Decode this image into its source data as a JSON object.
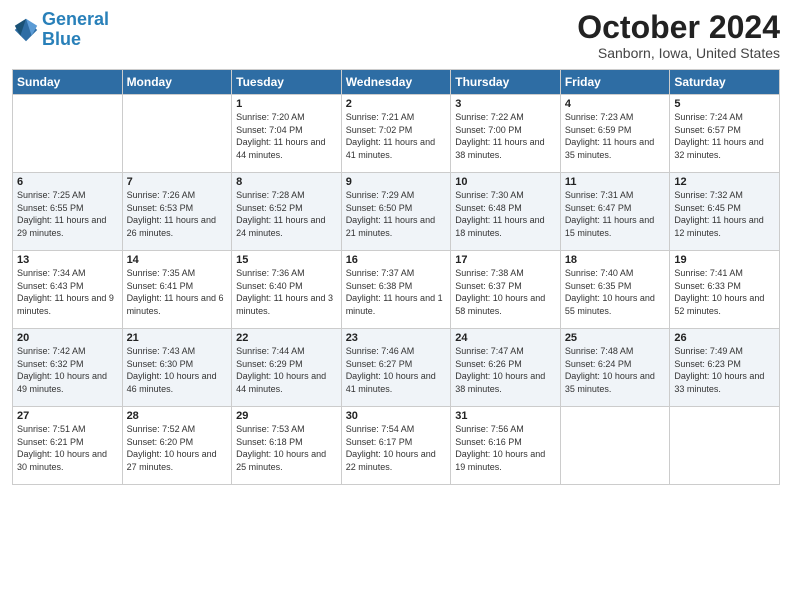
{
  "header": {
    "logo_line1": "General",
    "logo_line2": "Blue",
    "month": "October 2024",
    "location": "Sanborn, Iowa, United States"
  },
  "days_of_week": [
    "Sunday",
    "Monday",
    "Tuesday",
    "Wednesday",
    "Thursday",
    "Friday",
    "Saturday"
  ],
  "weeks": [
    [
      {
        "num": "",
        "info": ""
      },
      {
        "num": "",
        "info": ""
      },
      {
        "num": "1",
        "info": "Sunrise: 7:20 AM\nSunset: 7:04 PM\nDaylight: 11 hours and 44 minutes."
      },
      {
        "num": "2",
        "info": "Sunrise: 7:21 AM\nSunset: 7:02 PM\nDaylight: 11 hours and 41 minutes."
      },
      {
        "num": "3",
        "info": "Sunrise: 7:22 AM\nSunset: 7:00 PM\nDaylight: 11 hours and 38 minutes."
      },
      {
        "num": "4",
        "info": "Sunrise: 7:23 AM\nSunset: 6:59 PM\nDaylight: 11 hours and 35 minutes."
      },
      {
        "num": "5",
        "info": "Sunrise: 7:24 AM\nSunset: 6:57 PM\nDaylight: 11 hours and 32 minutes."
      }
    ],
    [
      {
        "num": "6",
        "info": "Sunrise: 7:25 AM\nSunset: 6:55 PM\nDaylight: 11 hours and 29 minutes."
      },
      {
        "num": "7",
        "info": "Sunrise: 7:26 AM\nSunset: 6:53 PM\nDaylight: 11 hours and 26 minutes."
      },
      {
        "num": "8",
        "info": "Sunrise: 7:28 AM\nSunset: 6:52 PM\nDaylight: 11 hours and 24 minutes."
      },
      {
        "num": "9",
        "info": "Sunrise: 7:29 AM\nSunset: 6:50 PM\nDaylight: 11 hours and 21 minutes."
      },
      {
        "num": "10",
        "info": "Sunrise: 7:30 AM\nSunset: 6:48 PM\nDaylight: 11 hours and 18 minutes."
      },
      {
        "num": "11",
        "info": "Sunrise: 7:31 AM\nSunset: 6:47 PM\nDaylight: 11 hours and 15 minutes."
      },
      {
        "num": "12",
        "info": "Sunrise: 7:32 AM\nSunset: 6:45 PM\nDaylight: 11 hours and 12 minutes."
      }
    ],
    [
      {
        "num": "13",
        "info": "Sunrise: 7:34 AM\nSunset: 6:43 PM\nDaylight: 11 hours and 9 minutes."
      },
      {
        "num": "14",
        "info": "Sunrise: 7:35 AM\nSunset: 6:41 PM\nDaylight: 11 hours and 6 minutes."
      },
      {
        "num": "15",
        "info": "Sunrise: 7:36 AM\nSunset: 6:40 PM\nDaylight: 11 hours and 3 minutes."
      },
      {
        "num": "16",
        "info": "Sunrise: 7:37 AM\nSunset: 6:38 PM\nDaylight: 11 hours and 1 minute."
      },
      {
        "num": "17",
        "info": "Sunrise: 7:38 AM\nSunset: 6:37 PM\nDaylight: 10 hours and 58 minutes."
      },
      {
        "num": "18",
        "info": "Sunrise: 7:40 AM\nSunset: 6:35 PM\nDaylight: 10 hours and 55 minutes."
      },
      {
        "num": "19",
        "info": "Sunrise: 7:41 AM\nSunset: 6:33 PM\nDaylight: 10 hours and 52 minutes."
      }
    ],
    [
      {
        "num": "20",
        "info": "Sunrise: 7:42 AM\nSunset: 6:32 PM\nDaylight: 10 hours and 49 minutes."
      },
      {
        "num": "21",
        "info": "Sunrise: 7:43 AM\nSunset: 6:30 PM\nDaylight: 10 hours and 46 minutes."
      },
      {
        "num": "22",
        "info": "Sunrise: 7:44 AM\nSunset: 6:29 PM\nDaylight: 10 hours and 44 minutes."
      },
      {
        "num": "23",
        "info": "Sunrise: 7:46 AM\nSunset: 6:27 PM\nDaylight: 10 hours and 41 minutes."
      },
      {
        "num": "24",
        "info": "Sunrise: 7:47 AM\nSunset: 6:26 PM\nDaylight: 10 hours and 38 minutes."
      },
      {
        "num": "25",
        "info": "Sunrise: 7:48 AM\nSunset: 6:24 PM\nDaylight: 10 hours and 35 minutes."
      },
      {
        "num": "26",
        "info": "Sunrise: 7:49 AM\nSunset: 6:23 PM\nDaylight: 10 hours and 33 minutes."
      }
    ],
    [
      {
        "num": "27",
        "info": "Sunrise: 7:51 AM\nSunset: 6:21 PM\nDaylight: 10 hours and 30 minutes."
      },
      {
        "num": "28",
        "info": "Sunrise: 7:52 AM\nSunset: 6:20 PM\nDaylight: 10 hours and 27 minutes."
      },
      {
        "num": "29",
        "info": "Sunrise: 7:53 AM\nSunset: 6:18 PM\nDaylight: 10 hours and 25 minutes."
      },
      {
        "num": "30",
        "info": "Sunrise: 7:54 AM\nSunset: 6:17 PM\nDaylight: 10 hours and 22 minutes."
      },
      {
        "num": "31",
        "info": "Sunrise: 7:56 AM\nSunset: 6:16 PM\nDaylight: 10 hours and 19 minutes."
      },
      {
        "num": "",
        "info": ""
      },
      {
        "num": "",
        "info": ""
      }
    ]
  ]
}
